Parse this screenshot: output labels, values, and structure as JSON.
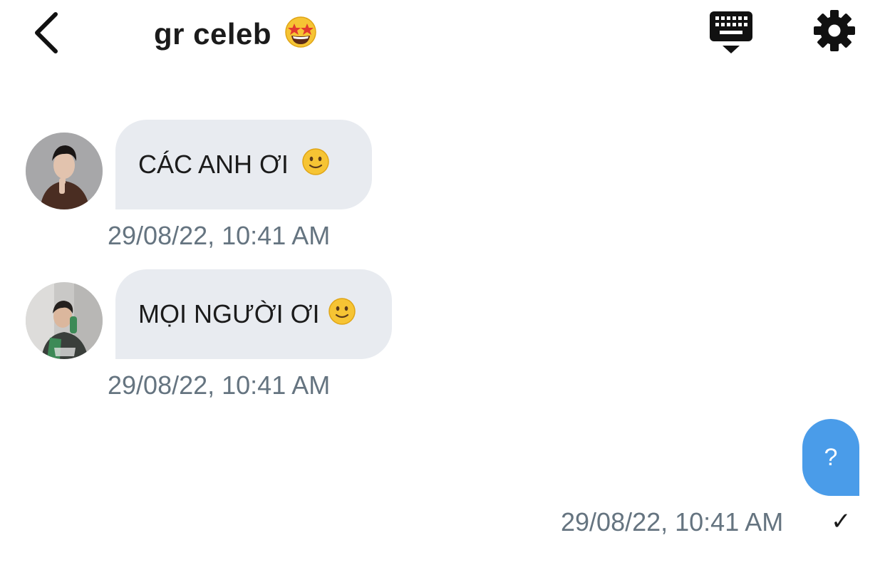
{
  "header": {
    "title": "gr celeb",
    "title_emoji": "🤩",
    "back_icon": "chevron-left-icon",
    "keyboard_icon": "keyboard-hide-icon",
    "settings_icon": "gear-icon"
  },
  "messages": [
    {
      "direction": "incoming",
      "text": "CÁC ANH ƠI",
      "emoji": "🙂",
      "timestamp": "29/08/22, 10:41 AM"
    },
    {
      "direction": "incoming",
      "text": "MỌI NGƯỜI ƠI",
      "emoji": "🙂",
      "timestamp": "29/08/22, 10:41 AM"
    },
    {
      "direction": "outgoing",
      "text": "?",
      "timestamp": "29/08/22, 10:41 AM",
      "status": "✓"
    }
  ],
  "colors": {
    "incoming_bubble": "#e8ebf0",
    "outgoing_bubble": "#4a9ce9",
    "timestamp": "#657480",
    "text": "#1b1b1b"
  }
}
